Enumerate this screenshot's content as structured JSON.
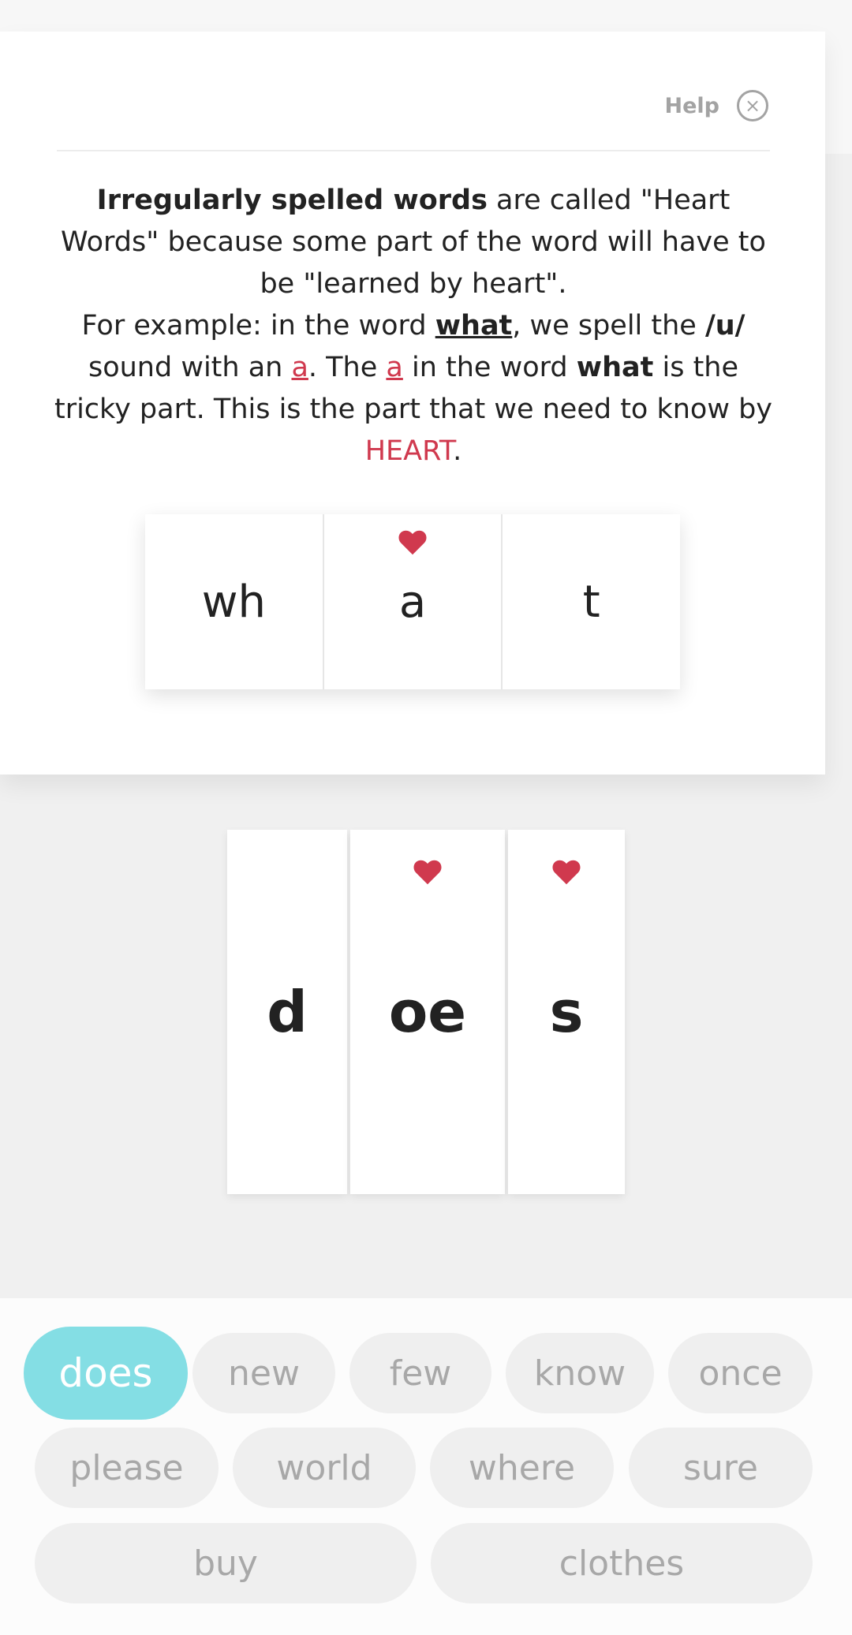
{
  "help": {
    "label": "Help",
    "close_glyph": "×",
    "explanation": {
      "p1_bold": "Irregularly spelled words",
      "p1_rest": " are called \"Heart Words\" because some part of the word will have to be \"learned by heart\".",
      "p2_a": "For example: in the word ",
      "p2_word": "what",
      "p2_b": ", we spell the ",
      "p2_sound": "/u/",
      "p2_c": " sound with an ",
      "p2_letter1": "a",
      "p2_d": ". The ",
      "p2_letter2": "a",
      "p2_e": " in the word ",
      "p2_word2": "what",
      "p2_f": " is the tricky part. This is the part that we need to know by ",
      "p2_heart": "HEART",
      "p2_end": "."
    },
    "sample_word": {
      "parts": [
        {
          "text": "wh",
          "heart": false
        },
        {
          "text": "a",
          "heart": true
        },
        {
          "text": "t",
          "heart": false
        }
      ]
    }
  },
  "current_word": {
    "parts": [
      {
        "text": "d",
        "heart": false
      },
      {
        "text": "oe",
        "heart": true
      },
      {
        "text": "s",
        "heart": true
      }
    ]
  },
  "word_bank": {
    "selected": "does",
    "words": [
      "does",
      "new",
      "few",
      "know",
      "once",
      "please",
      "world",
      "where",
      "sure",
      "buy",
      "clothes"
    ]
  },
  "colors": {
    "heart": "#d0394e",
    "selected_chip": "#84dee4",
    "chip": "#efefef"
  },
  "icons": {
    "heart": "heart-icon",
    "close": "close-icon"
  }
}
